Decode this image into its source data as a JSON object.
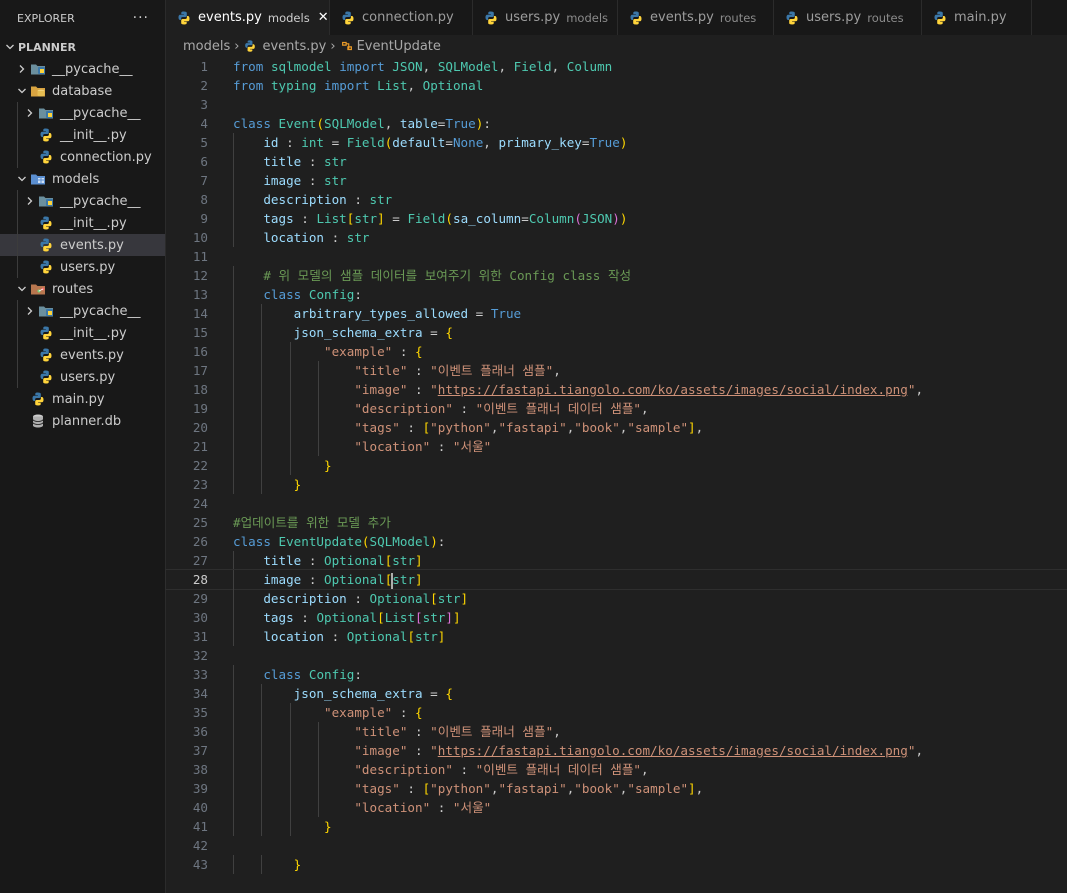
{
  "explorer": {
    "title": "EXPLORER",
    "more": "···",
    "root": "PLANNER",
    "items": [
      {
        "label": "__pycache__",
        "depth": 1,
        "kind": "folder-cache",
        "expanded": false
      },
      {
        "label": "database",
        "depth": 1,
        "kind": "folder-db",
        "expanded": true
      },
      {
        "label": "__pycache__",
        "depth": 2,
        "kind": "folder-cache",
        "expanded": false
      },
      {
        "label": "__init__.py",
        "depth": 2,
        "kind": "python",
        "expanded": null
      },
      {
        "label": "connection.py",
        "depth": 2,
        "kind": "python",
        "expanded": null
      },
      {
        "label": "models",
        "depth": 1,
        "kind": "folder-models",
        "expanded": true
      },
      {
        "label": "__pycache__",
        "depth": 2,
        "kind": "folder-cache",
        "expanded": false
      },
      {
        "label": "__init__.py",
        "depth": 2,
        "kind": "python",
        "expanded": null
      },
      {
        "label": "events.py",
        "depth": 2,
        "kind": "python",
        "expanded": null,
        "selected": true
      },
      {
        "label": "users.py",
        "depth": 2,
        "kind": "python",
        "expanded": null
      },
      {
        "label": "routes",
        "depth": 1,
        "kind": "folder-routes",
        "expanded": true
      },
      {
        "label": "__pycache__",
        "depth": 2,
        "kind": "folder-cache",
        "expanded": false
      },
      {
        "label": "__init__.py",
        "depth": 2,
        "kind": "python",
        "expanded": null
      },
      {
        "label": "events.py",
        "depth": 2,
        "kind": "python",
        "expanded": null
      },
      {
        "label": "users.py",
        "depth": 2,
        "kind": "python",
        "expanded": null
      },
      {
        "label": "main.py",
        "depth": 1,
        "kind": "python",
        "expanded": null
      },
      {
        "label": "planner.db",
        "depth": 1,
        "kind": "database",
        "expanded": null
      }
    ]
  },
  "tabs": [
    {
      "label": "events.py",
      "desc": "models",
      "active": true,
      "close": "✕"
    },
    {
      "label": "connection.py",
      "desc": "",
      "active": false
    },
    {
      "label": "users.py",
      "desc": "models",
      "active": false
    },
    {
      "label": "events.py",
      "desc": "routes",
      "active": false
    },
    {
      "label": "users.py",
      "desc": "routes",
      "active": false
    },
    {
      "label": "main.py",
      "desc": "",
      "active": false
    }
  ],
  "breadcrumb": {
    "folder": "models",
    "file": "events.py",
    "symbol": "EventUpdate"
  },
  "editor": {
    "current_line": 28,
    "lines": [
      "from sqlmodel import JSON, SQLModel, Field, Column",
      "from typing import List, Optional",
      "",
      "class Event(SQLModel, table=True):",
      "    id : int = Field(default=None, primary_key=True)",
      "    title : str",
      "    image : str",
      "    description : str",
      "    tags : List[str] = Field(sa_column=Column(JSON))",
      "    location : str",
      "",
      "    # 위 모델의 샘플 데이터를 보여주기 위한 Config class 작성",
      "    class Config:",
      "        arbitrary_types_allowed = True",
      "        json_schema_extra = {",
      "            \"example\" : {",
      "                \"title\" : \"이벤트 플래너 샘플\",",
      "                \"image\" : \"https://fastapi.tiangolo.com/ko/assets/images/social/index.png\",",
      "                \"description\" : \"이벤트 플래너 데이터 샘플\",",
      "                \"tags\" : [\"python\",\"fastapi\",\"book\",\"sample\"],",
      "                \"location\" : \"서울\"",
      "            }",
      "        }",
      "",
      "#업데이트를 위한 모델 추가",
      "class EventUpdate(SQLModel):",
      "    title : Optional[str]",
      "    image : Optional[str]",
      "    description : Optional[str]",
      "    tags : Optional[List[str]]",
      "    location : Optional[str]",
      "",
      "    class Config:",
      "        json_schema_extra = {",
      "            \"example\" : {",
      "                \"title\" : \"이벤트 플래너 샘플\",",
      "                \"image\" : \"https://fastapi.tiangolo.com/ko/assets/images/social/index.png\",",
      "                \"description\" : \"이벤트 플래너 데이터 샘플\",",
      "                \"tags\" : [\"python\",\"fastapi\",\"book\",\"sample\"],",
      "                \"location\" : \"서울\"",
      "            }",
      "",
      "        }"
    ]
  },
  "colors": {
    "keyword": "#569cd6",
    "class": "#4ec9b0",
    "string": "#ce9178",
    "variable": "#9cdcfe",
    "comment": "#6a9955",
    "python_blue": "#3b77a8",
    "python_yellow": "#ffd43b"
  }
}
